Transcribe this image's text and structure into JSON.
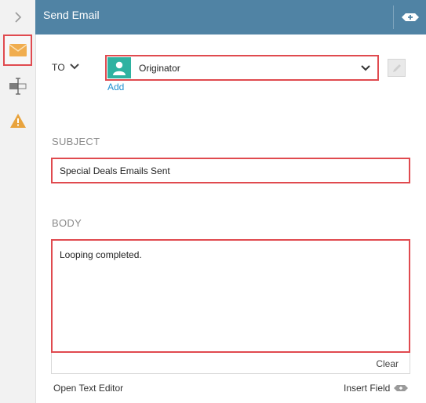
{
  "header": {
    "title": "Send Email",
    "add_icon": "add-step-icon"
  },
  "sidebar": {
    "items": [
      {
        "name": "expand",
        "icon": "chevron-right-icon"
      },
      {
        "name": "email",
        "icon": "envelope-icon",
        "selected": true
      },
      {
        "name": "text-field",
        "icon": "text-field-icon"
      },
      {
        "name": "warning",
        "icon": "warning-icon"
      }
    ]
  },
  "to": {
    "label": "TO",
    "value": "Originator",
    "add_label": "Add",
    "avatar_icon": "user-icon"
  },
  "subject": {
    "label": "SUBJECT",
    "value": "Special Deals Emails Sent"
  },
  "body": {
    "label": "BODY",
    "value": "Looping completed.",
    "clear_label": "Clear"
  },
  "footer": {
    "open_editor_label": "Open Text Editor",
    "insert_field_label": "Insert Field"
  },
  "colors": {
    "header": "#5083a4",
    "highlight": "#e04a4f",
    "avatar": "#2fb2a1",
    "link": "#1e8fd1",
    "email_icon": "#f0ad4e",
    "warning_icon": "#e8a33d"
  }
}
